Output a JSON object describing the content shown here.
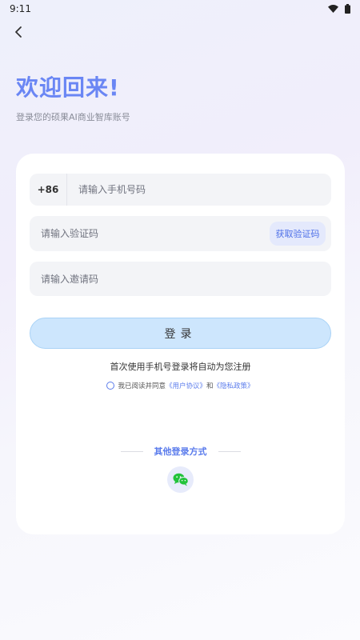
{
  "status_bar": {
    "time": "9:11"
  },
  "header": {
    "title": "欢迎回来!",
    "subtitle": "登录您的硕果AI商业智库账号"
  },
  "form": {
    "phone_prefix": "+86",
    "phone_placeholder": "请输入手机号码",
    "phone_value": "",
    "code_placeholder": "请输入验证码",
    "code_value": "",
    "get_code_label": "获取验证码",
    "invite_placeholder": "请输入邀请码",
    "invite_value": "",
    "login_label": "登录",
    "register_hint": "首次使用手机号登录将自动为您注册",
    "agreement": {
      "checked": false,
      "prefix": "我已阅读并同意",
      "user_agreement": "《用户协议》",
      "and": "和",
      "privacy_policy": "《隐私政策》"
    }
  },
  "other_login": {
    "label": "其他登录方式",
    "wechat_icon": "wechat-icon"
  },
  "colors": {
    "accent": "#6a86f4",
    "link": "#5b7cec",
    "login_button_bg": "#cde6fd",
    "wechat_green": "#22c33b"
  }
}
